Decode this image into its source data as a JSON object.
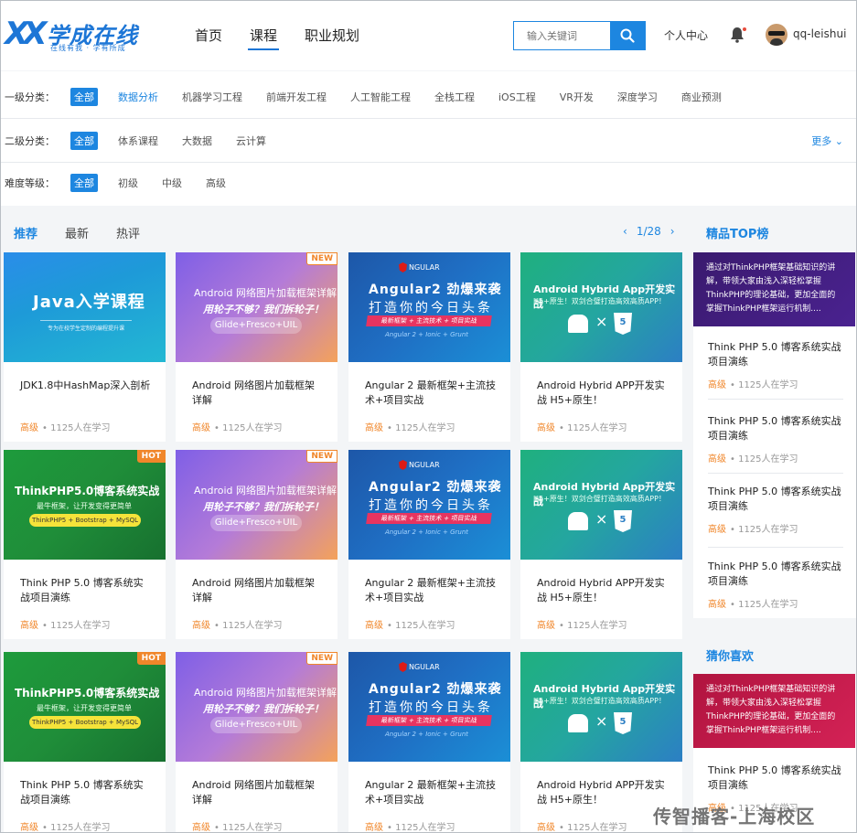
{
  "header": {
    "logo_title": "学成在线",
    "logo_sub": "在线有我 · 学有所成",
    "nav": [
      "首页",
      "课程",
      "职业规划"
    ],
    "search_placeholder": "输入关键词",
    "user_center": "个人中心",
    "username": "qq-leishui"
  },
  "filters": {
    "level1": {
      "label": "一级分类：",
      "options": [
        "全部",
        "数据分析",
        "机器学习工程",
        "前端开发工程",
        "人工智能工程",
        "全栈工程",
        "iOS工程",
        "VR开发",
        "深度学习",
        "商业预测"
      ]
    },
    "level2": {
      "label": "二级分类：",
      "options": [
        "全部",
        "体系课程",
        "大数据",
        "云计算"
      ]
    },
    "difficulty": {
      "label": "难度等级：",
      "options": [
        "全部",
        "初级",
        "中级",
        "高级"
      ]
    },
    "more": "更多"
  },
  "tabs": [
    "推荐",
    "最新",
    "热评"
  ],
  "pager": {
    "prev": "‹",
    "text": "1/28",
    "next": "›"
  },
  "thumbs": {
    "java": {
      "big": "Java入学课程",
      "small": "专为在校学生定制的编程提升课"
    },
    "android": {
      "l1": "Android 网络图片加载框架详解",
      "l2": "用轮子不够？我们拆轮子！",
      "l3": "Glide+Fresco+UIL"
    },
    "ng": {
      "l0": "NGULAR",
      "l1": "Angular2 劲爆来袭",
      "l2": "打造你的今日头条",
      "l3": "最新框架 + 主流技术 + 项目实战",
      "l4": "Angular 2 + Ionic + Grunt"
    },
    "hy": {
      "l1": "Android Hybrid App开发实战",
      "l2": "H5+原生！双剑合璧打造高效高质APP！",
      "x": "×",
      "h5": "5"
    },
    "php": {
      "l1": "ThinkPHP5.0博客系统实战",
      "l2": "最牛框架，让开发变得更简单",
      "l3": "ThinkPHP5 + Bootstrap + MySQL"
    }
  },
  "badges": {
    "new": "NEW",
    "hot": "HOT"
  },
  "courses": [
    {
      "title": "JDK1.8中HashMap深入剖析",
      "level": "高级",
      "learners": "1125人在学习"
    },
    {
      "title": "Android 网络图片加载框架详解",
      "level": "高级",
      "learners": "1125人在学习"
    },
    {
      "title": "Angular 2 最新框架+主流技术+项目实战",
      "level": "高级",
      "learners": "1125人在学习"
    },
    {
      "title": "Android Hybrid APP开发实战 H5+原生！",
      "level": "高级",
      "learners": "1125人在学习"
    },
    {
      "title": "Think PHP 5.0 博客系统实战项目演练",
      "level": "高级",
      "learners": "1125人在学习"
    },
    {
      "title": "Android 网络图片加载框架详解",
      "level": "高级",
      "learners": "1125人在学习"
    },
    {
      "title": "Angular 2 最新框架+主流技术+项目实战",
      "level": "高级",
      "learners": "1125人在学习"
    },
    {
      "title": "Android Hybrid APP开发实战 H5+原生！",
      "level": "高级",
      "learners": "1125人在学习"
    },
    {
      "title": "Think PHP 5.0 博客系统实战项目演练",
      "level": "高级",
      "learners": "1125人在学习"
    },
    {
      "title": "Android 网络图片加载框架详解",
      "level": "高级",
      "learners": "1125人在学习"
    },
    {
      "title": "Angular 2 最新框架+主流技术+项目实战",
      "level": "高级",
      "learners": "1125人在学习"
    },
    {
      "title": "Android Hybrid APP开发实战 H5+原生！",
      "level": "高级",
      "learners": "1125人在学习"
    }
  ],
  "sidebar": {
    "top_title": "精品TOP榜",
    "top_banner": "通过对ThinkPHP框架基础知识的讲解，带领大家由浅入深轻松掌握ThinkPHP的理论基础，更加全面的掌握ThinkPHP框架运行机制....",
    "top_items": [
      {
        "title": "Think PHP 5.0 博客系统实战项目演练",
        "level": "高级",
        "learners": "1125人在学习"
      },
      {
        "title": "Think PHP 5.0 博客系统实战项目演练",
        "level": "高级",
        "learners": "1125人在学习"
      },
      {
        "title": "Think PHP 5.0 博客系统实战项目演练",
        "level": "高级",
        "learners": "1125人在学习"
      },
      {
        "title": "Think PHP 5.0 博客系统实战项目演练",
        "level": "高级",
        "learners": "1125人在学习"
      }
    ],
    "guess_title": "猜你喜欢",
    "guess_banner": "通过对ThinkPHP框架基础知识的讲解，带领大家由浅入深轻松掌握ThinkPHP的理论基础，更加全面的掌握ThinkPHP框架运行机制....",
    "guess_items": [
      {
        "title": "Think PHP 5.0 博客系统实战项目演练",
        "level": "高级",
        "learners": "1125人在学习"
      }
    ]
  },
  "watermark": "传智播客-上海校区"
}
